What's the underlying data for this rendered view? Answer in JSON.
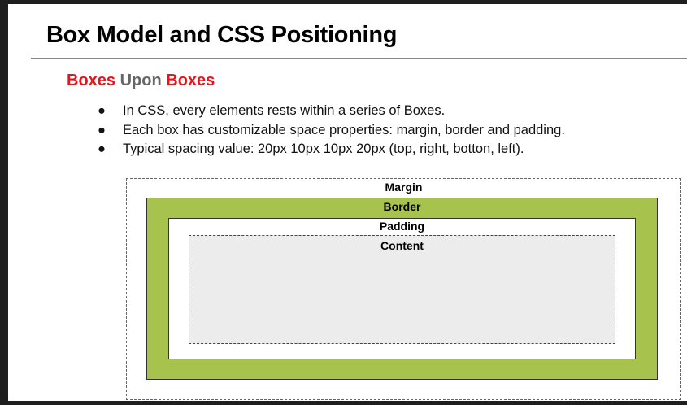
{
  "title": "Box Model and CSS Positioning",
  "subtitle": {
    "part1": "Boxes",
    "part2": "Upon",
    "part3": "Boxes"
  },
  "bullets": [
    "In CSS, every elements rests within a series of Boxes.",
    "Each box has customizable space properties: margin, border and padding.",
    "Typical spacing value: 20px 10px 10px 20px (top, right, botton, left)."
  ],
  "bullet_glyph": "●",
  "diagram": {
    "margin": "Margin",
    "border": "Border",
    "padding": "Padding",
    "content": "Content"
  },
  "colors": {
    "accent_red": "#e8141b",
    "border_green": "#a8c34d",
    "content_gray": "#ececec"
  }
}
